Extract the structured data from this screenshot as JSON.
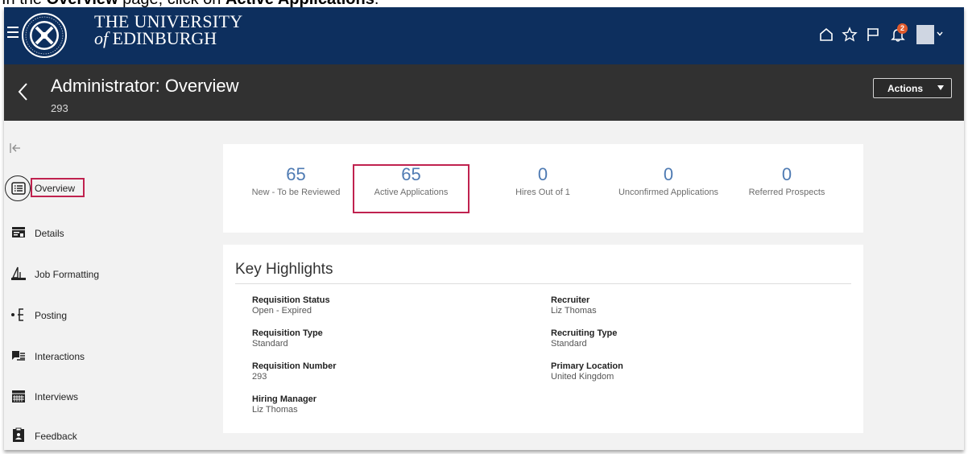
{
  "instruction": {
    "prefix": "In the ",
    "bold1": "Overview",
    "middle": " page, click on ",
    "bold2": "Active Applications",
    "suffix": "."
  },
  "header": {
    "brand_line1": "THE UNIVERSITY",
    "brand_line2_of": "of",
    "brand_line2_rest": " EDINBURGH",
    "notification_count": "2",
    "bg_color": "#0d2f5e"
  },
  "titlebar": {
    "title": "Administrator: Overview",
    "subtitle": "293",
    "actions_label": "Actions"
  },
  "sidebar": {
    "items": [
      {
        "label": "Overview",
        "icon": "overview-icon"
      },
      {
        "label": "Details",
        "icon": "details-icon"
      },
      {
        "label": "Job Formatting",
        "icon": "job-formatting-icon"
      },
      {
        "label": "Posting",
        "icon": "posting-icon"
      },
      {
        "label": "Interactions",
        "icon": "interactions-icon"
      },
      {
        "label": "Interviews",
        "icon": "interviews-icon"
      },
      {
        "label": "Feedback",
        "icon": "feedback-icon"
      }
    ]
  },
  "stats": [
    {
      "value": "65",
      "label": "New - To be Reviewed"
    },
    {
      "value": "65",
      "label": "Active Applications"
    },
    {
      "value": "0",
      "label": "Hires Out of 1"
    },
    {
      "value": "0",
      "label": "Unconfirmed Applications"
    },
    {
      "value": "0",
      "label": "Referred Prospects"
    }
  ],
  "key_highlights": {
    "title": "Key Highlights",
    "left": [
      {
        "label": "Requisition Status",
        "value": "Open - Expired"
      },
      {
        "label": "Requisition Type",
        "value": "Standard"
      },
      {
        "label": "Requisition Number",
        "value": "293"
      },
      {
        "label": "Hiring Manager",
        "value": "Liz Thomas"
      }
    ],
    "right": [
      {
        "label": "Recruiter",
        "value": "Liz Thomas"
      },
      {
        "label": "Recruiting Type",
        "value": "Standard"
      },
      {
        "label": "Primary Location",
        "value": "United Kingdom"
      }
    ]
  },
  "colors": {
    "accent_blue": "#4f7bb3",
    "highlight_red": "#c0224f",
    "titlebar": "#313131"
  }
}
